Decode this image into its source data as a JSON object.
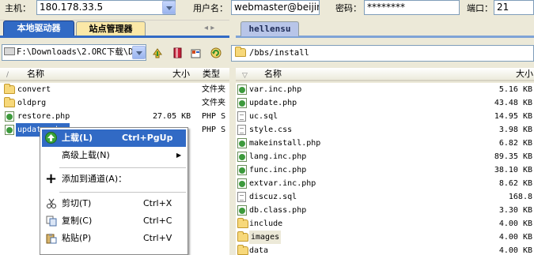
{
  "connect_bar": {
    "host_label": "主机：",
    "host_value": "180.178.33.5",
    "user_label": "用户名：",
    "user_value": "webmaster@beijingn",
    "pass_label": "密码：",
    "pass_value": "********",
    "port_label": "端口：",
    "port_value": "21"
  },
  "left": {
    "tabs": [
      "本地驱动器",
      "站点管理器"
    ],
    "path": "F:\\Downloads\\2.ORC下载\\D",
    "columns": {
      "name": "名称",
      "size": "大小",
      "type": "类型"
    },
    "files": [
      {
        "name": "convert",
        "size": "",
        "type": "文件夹",
        "icon": "folder-icon"
      },
      {
        "name": "oldprg",
        "size": "",
        "type": "文件夹",
        "icon": "folder-icon"
      },
      {
        "name": "restore.php",
        "size": "27.05 KB",
        "type": "PHP S",
        "icon": "php-file-icon"
      },
      {
        "name": "update.php",
        "size": "",
        "type": "PHP S",
        "icon": "php-file-icon"
      }
    ]
  },
  "right": {
    "tab": "hellensu",
    "path": "/bbs/install",
    "columns": {
      "name": "名称",
      "size": "大小"
    },
    "files": [
      {
        "name": "var.inc.php",
        "size": "5.16 KB",
        "icon": "php-file-icon"
      },
      {
        "name": "update.php",
        "size": "43.48 KB",
        "icon": "php-file-icon"
      },
      {
        "name": "uc.sql",
        "size": "14.95 KB",
        "icon": "document-icon"
      },
      {
        "name": "style.css",
        "size": "3.98 KB",
        "icon": "document-icon"
      },
      {
        "name": "makeinstall.php",
        "size": "6.82 KB",
        "icon": "php-file-icon"
      },
      {
        "name": "lang.inc.php",
        "size": "89.35 KB",
        "icon": "php-file-icon"
      },
      {
        "name": "func.inc.php",
        "size": "38.10 KB",
        "icon": "php-file-icon"
      },
      {
        "name": "extvar.inc.php",
        "size": "8.62 KB",
        "icon": "php-file-icon"
      },
      {
        "name": "discuz.sql",
        "size": "168.8",
        "icon": "document-icon"
      },
      {
        "name": "db.class.php",
        "size": "3.30 KB",
        "icon": "php-file-icon"
      },
      {
        "name": "include",
        "size": "4.00 KB",
        "icon": "folder-icon"
      },
      {
        "name": "images",
        "size": "4.00 KB",
        "icon": "folder-icon"
      },
      {
        "name": "data",
        "size": "4.00 KB",
        "icon": "folder-icon"
      }
    ]
  },
  "context_menu": {
    "upload": {
      "label": "上载(L)",
      "shortcut": "Ctrl+PgUp"
    },
    "advanced_upload": {
      "label": "高级上载(N)"
    },
    "add_to_channel": {
      "label": "添加到通道(A)："
    },
    "cut": {
      "label": "剪切(T)",
      "shortcut": "Ctrl+X"
    },
    "copy": {
      "label": "复制(C)",
      "shortcut": "Ctrl+C"
    },
    "paste": {
      "label": "粘贴(P)",
      "shortcut": "Ctrl+V"
    }
  },
  "colors": {
    "selection": "#316ac5",
    "window_bg": "#ece9d8"
  }
}
